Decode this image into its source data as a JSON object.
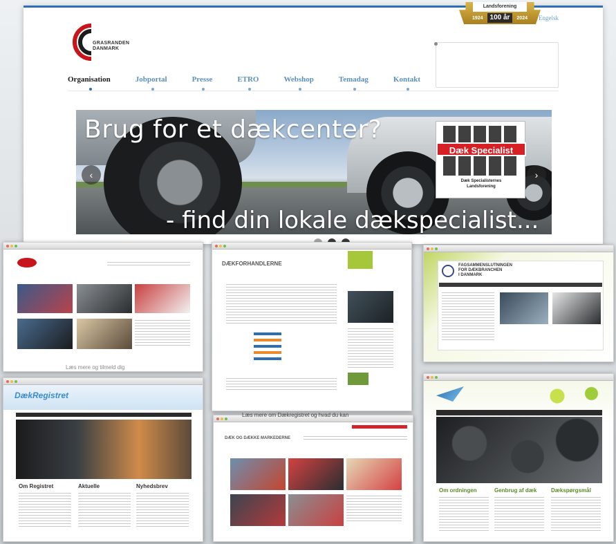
{
  "header": {
    "lang_link": "Engelsk",
    "logo_text_line1": "GRASRANDEN",
    "logo_text_line2": "DANMARK",
    "badge_top": "Landsforening",
    "badge_year_start": "1924",
    "badge_mid": "100 år",
    "badge_year_end": "2024"
  },
  "nav": {
    "items": [
      {
        "label": "Organisation"
      },
      {
        "label": "Jobportal"
      },
      {
        "label": "Presse"
      },
      {
        "label": "ETRO"
      },
      {
        "label": "Webshop"
      },
      {
        "label": "Temadag"
      },
      {
        "label": "Kontakt"
      }
    ]
  },
  "hero": {
    "headline": "Brug for et dækcenter?",
    "subline": "- find din lokale dækspecialist...",
    "prev_icon": "‹",
    "next_icon": "›",
    "dek_label": "Dæk Specialist",
    "dek_sub_line1": "Dæk Specialisternes",
    "dek_sub_line2": "Landsforening"
  },
  "thumbnails": {
    "t2_title": "DÆKFORHANDLERNE",
    "t3_title_line1": "FAGSAMMENSLUTNINGEN",
    "t3_title_line2": "FOR DÆKBRANCHEN",
    "t3_title_line3": "I DANMARK",
    "t5_title": "DÆK OG DÆKKE MARKEDERNE",
    "t4_logo": "DækRegistret",
    "captions_t4": [
      "Om Registret",
      "Aktuelle",
      "Nyhedsbrev"
    ],
    "captions_t6": [
      "Om ordningen",
      "Genbrug af dæk",
      "Dækspørgsmål"
    ],
    "banner_t1": "Læs mere og tilmeld dig",
    "banner_t5": "Læs mere om Dækregistret og hvad du kan"
  },
  "colors": {
    "accent": "#2d6fb3",
    "nav_link": "#5b8fc0",
    "dek_red": "#d71f26"
  }
}
